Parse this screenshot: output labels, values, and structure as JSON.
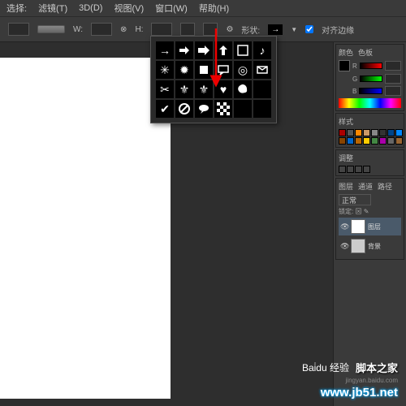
{
  "menu": {
    "select": "选择:",
    "filter": "滤镜(T)",
    "view3d": "3D(D)",
    "view": "视图(V)",
    "window": "窗口(W)",
    "help": "帮助(H)"
  },
  "options": {
    "w_label": "W:",
    "h_label": "H:",
    "gear": "⚙",
    "shape_label": "形状:",
    "align_label": "对齐边缘",
    "arrow": "→"
  },
  "shape_picker": {
    "shapes": [
      "arrow-thin",
      "arrow-right",
      "arrow-bold",
      "arrow-up",
      "square-outline",
      "music-note",
      "burst",
      "starburst",
      "tile-square",
      "talk-rect",
      "target",
      "envelope",
      "scissors",
      "fleur",
      "fleur-solid",
      "heart",
      "blob",
      "blank",
      "checkmark",
      "no-symbol",
      "speech-bubble",
      "checker",
      "blank2",
      "blank3"
    ]
  },
  "panels": {
    "color": {
      "tab1": "颜色",
      "tab2": "色板",
      "labels": {
        "r": "R",
        "g": "G",
        "b": "B"
      }
    },
    "styles": {
      "tab": "样式"
    },
    "adjust": {
      "tab": "调整"
    },
    "layers": {
      "tab1": "图层",
      "tab2": "通道",
      "tab3": "路径",
      "mode": "正常",
      "lock": "锁定:",
      "layer1": "图层",
      "bg": "背景"
    }
  },
  "watermark": {
    "baidu": "Bai̇du 经验",
    "site_cn": "脚本之家",
    "url": "www.jb51.net",
    "exp": "jingyan.baidu.com"
  }
}
